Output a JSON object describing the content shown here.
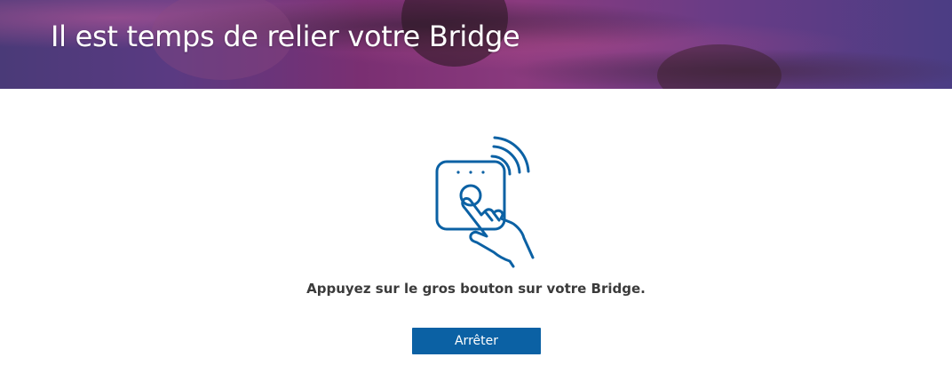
{
  "header": {
    "title": "Il est temps de relier votre Bridge"
  },
  "illustration": {
    "icon": "bridge-push-button-icon",
    "color": "#0b61a4"
  },
  "main": {
    "instruction": "Appuyez sur le gros bouton sur votre Bridge.",
    "stop_label": "Arrêter"
  },
  "colors": {
    "accent": "#0b61a4",
    "text": "#3b3b3b",
    "header_text": "#ffffff"
  }
}
